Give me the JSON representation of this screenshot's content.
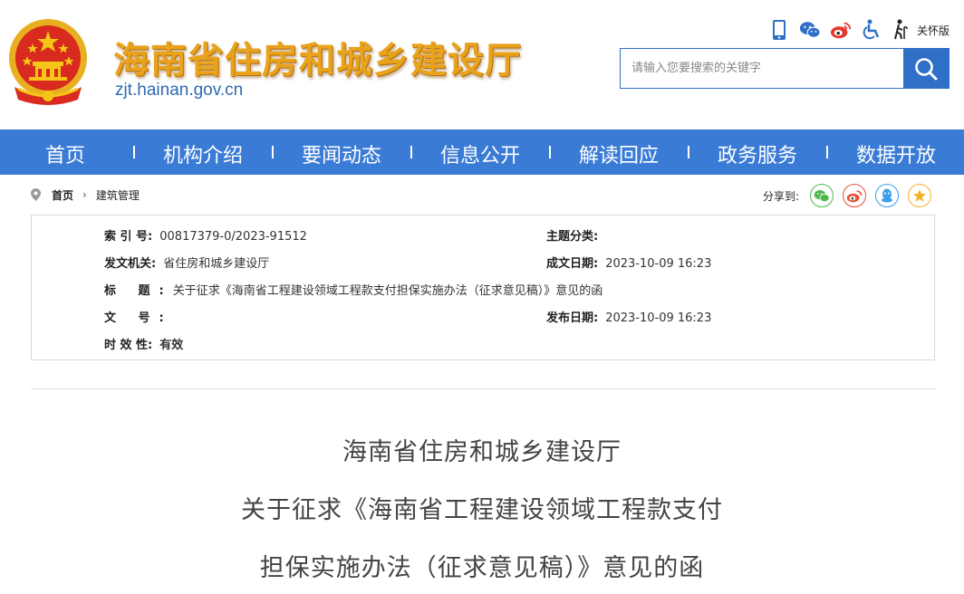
{
  "site": {
    "title": "海南省住房和城乡建设厅",
    "domain": "zjt.hainan.gov.cn"
  },
  "toolbar": {
    "icons": [
      "mobile-icon",
      "wechat-icon",
      "weibo-icon",
      "accessibility-icon",
      "elder-care-icon"
    ],
    "care_label": "关怀版"
  },
  "search": {
    "placeholder": "请输入您要搜索的关键字",
    "value": ""
  },
  "nav": {
    "items": [
      {
        "label": "首页"
      },
      {
        "label": "机构介绍"
      },
      {
        "label": "要闻动态"
      },
      {
        "label": "信息公开"
      },
      {
        "label": "解读回应"
      },
      {
        "label": "政务服务"
      },
      {
        "label": "数据开放"
      }
    ]
  },
  "breadcrumb": {
    "home": "首页",
    "separator": "›",
    "section": "建筑管理"
  },
  "share": {
    "label": "分享到:",
    "targets": [
      {
        "name": "wechat",
        "color": "#4cb84c"
      },
      {
        "name": "weibo",
        "color": "#e5533b"
      },
      {
        "name": "qq",
        "color": "#3aa0e8"
      },
      {
        "name": "qzone",
        "color": "#f0b429"
      }
    ]
  },
  "meta": {
    "index_label": "索 引 号:",
    "index_value": "00817379-0/2023-91512",
    "topic_label": "主题分类:",
    "topic_value": "",
    "issuer_label": "发文机关:",
    "issuer_value": "省住房和城乡建设厅",
    "created_label": "成文日期:",
    "created_value": "2023-10-09 16:23",
    "title_label": "标 题:",
    "title_value": "关于征求《海南省工程建设领域工程款支付担保实施办法（征求意见稿）》意见的函",
    "docno_label": "文 号:",
    "docno_value": "",
    "published_label": "发布日期:",
    "published_value": "2023-10-09 16:23",
    "validity_label": "时 效 性:",
    "validity_value": "有效"
  },
  "article": {
    "title_line1": "海南省住房和城乡建设厅",
    "title_line2": "关于征求《海南省工程建设领域工程款支付",
    "title_line3": "担保实施办法（征求意见稿）》意见的函"
  },
  "colors": {
    "nav_bg": "#3a7bd5",
    "title_gold": "#e8a21c",
    "domain_blue": "#2f6ab0",
    "search_blue": "#2f6fc8"
  }
}
